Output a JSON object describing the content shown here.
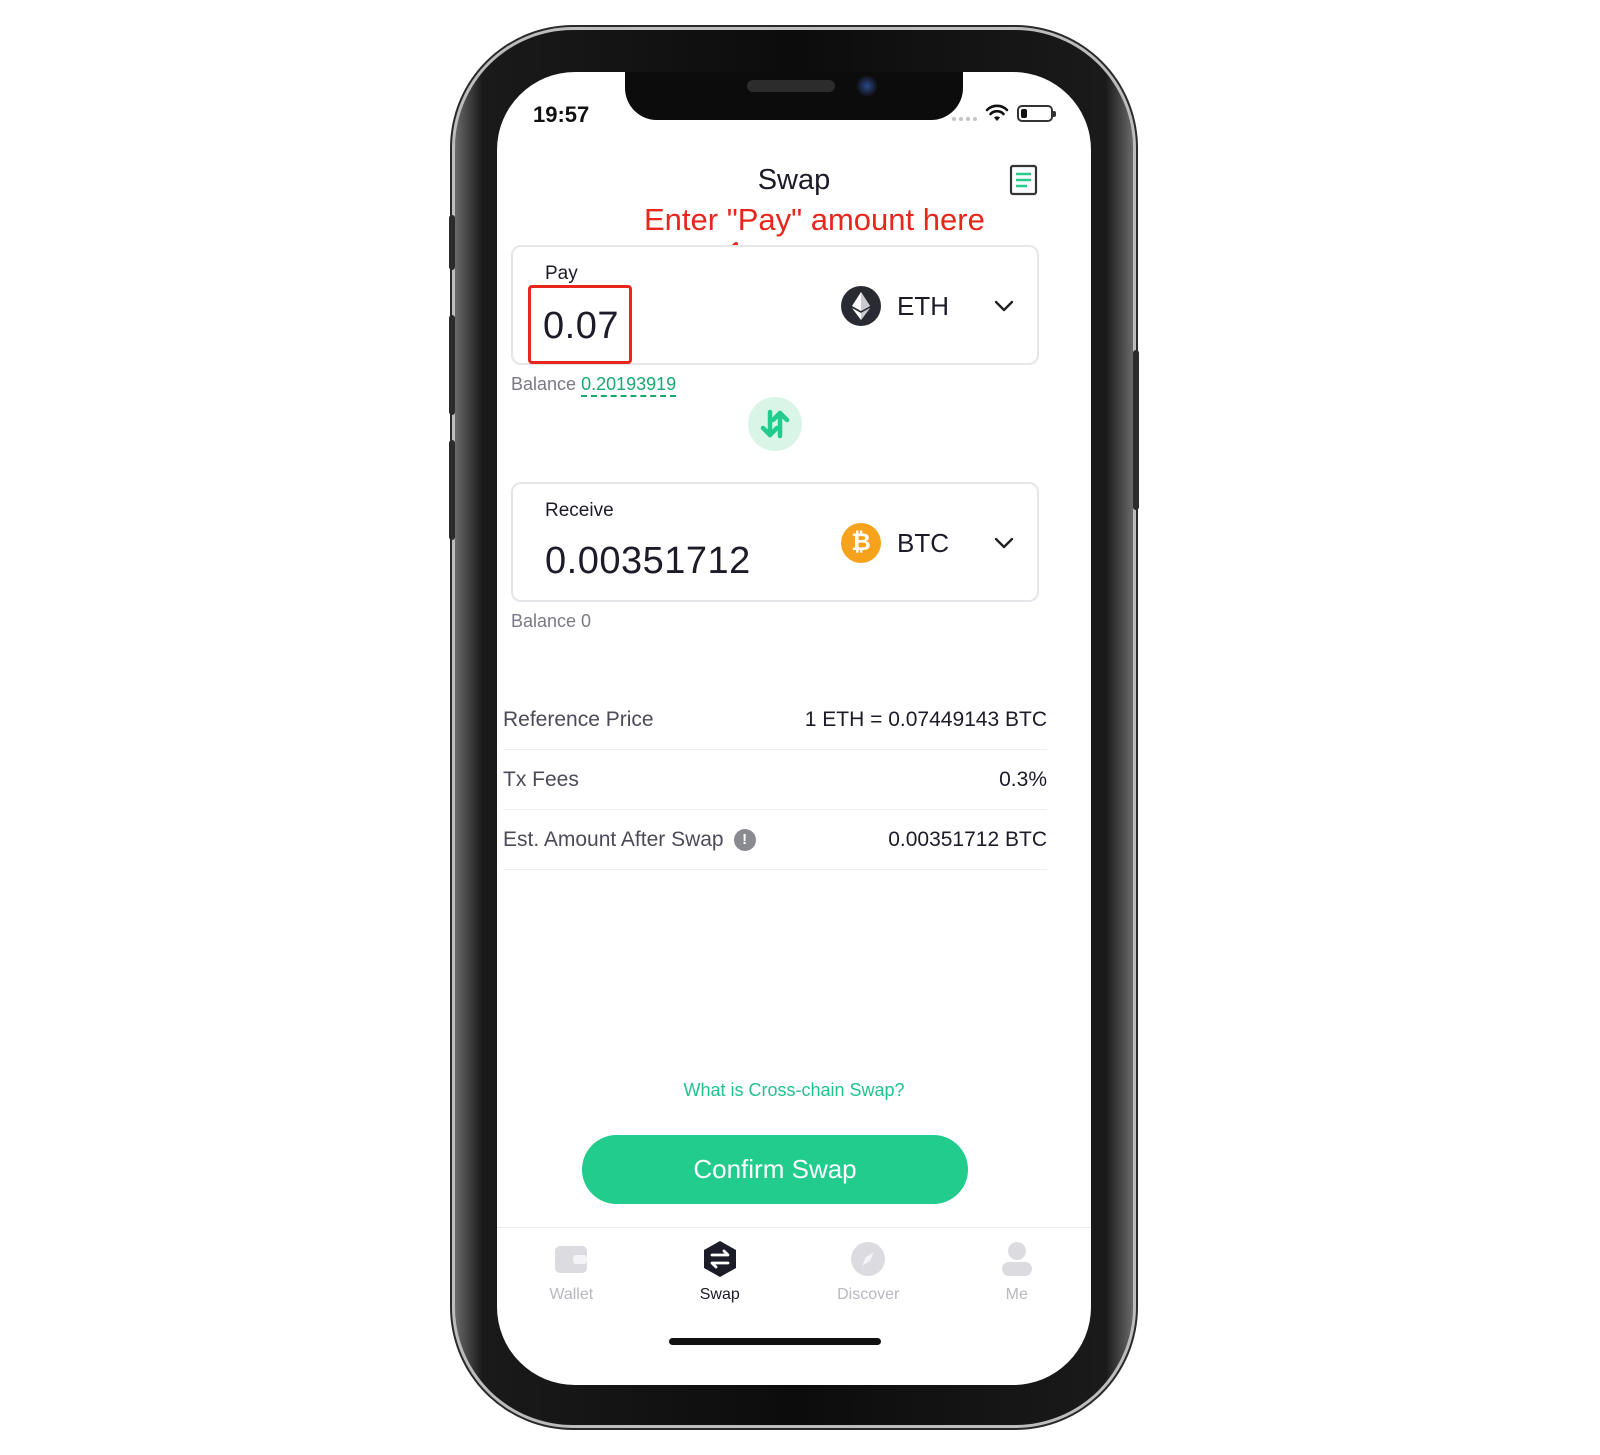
{
  "status_bar": {
    "time": "19:57"
  },
  "header": {
    "title": "Swap"
  },
  "annotation": {
    "text": "Enter \"Pay\" amount here"
  },
  "pay": {
    "label": "Pay",
    "amount": "0.07",
    "token": "ETH",
    "balance_label": "Balance",
    "balance_value": "0.20193919"
  },
  "receive": {
    "label": "Receive",
    "amount": "0.00351712",
    "token": "BTC",
    "balance_text": "Balance 0"
  },
  "info": {
    "rows": [
      {
        "label": "Reference Price",
        "value": "1 ETH = 0.07449143 BTC"
      },
      {
        "label": "Tx Fees",
        "value": "0.3%"
      },
      {
        "label": "Est. Amount After Swap",
        "value": "0.00351712 BTC"
      }
    ]
  },
  "cross_chain_link": "What is Cross-chain Swap?",
  "confirm_button": "Confirm Swap",
  "tab_bar": {
    "tabs": [
      {
        "label": "Wallet",
        "icon": "wallet-icon",
        "active": false
      },
      {
        "label": "Swap",
        "icon": "swap-icon",
        "active": true
      },
      {
        "label": "Discover",
        "icon": "compass-icon",
        "active": false
      },
      {
        "label": "Me",
        "icon": "person-icon",
        "active": false
      }
    ]
  },
  "colors": {
    "accent": "#21cc8d",
    "link": "#22c28b",
    "annotation": "#e8261c",
    "eth_logo": "#2a2a32",
    "btc_logo": "#f7a21b"
  }
}
